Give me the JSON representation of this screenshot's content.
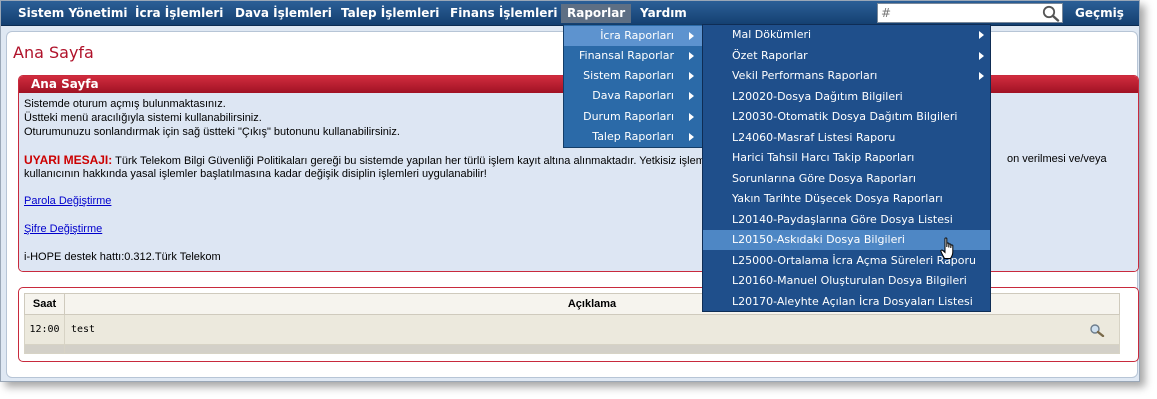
{
  "topmenu": {
    "items": [
      {
        "label": "Sistem Yönetimi"
      },
      {
        "label": "İcra İşlemleri"
      },
      {
        "label": "Dava İşlemleri"
      },
      {
        "label": "Talep İşlemleri"
      },
      {
        "label": "Finans İşlemleri"
      },
      {
        "label": "Raporlar"
      },
      {
        "label": "Yardım"
      }
    ],
    "search_placeholder": "#",
    "search_icon": "magnifier-icon",
    "history_label": "Geçmiş"
  },
  "page": {
    "title": "Ana Sayfa"
  },
  "home_panel": {
    "header": "Ana Sayfa",
    "lines": [
      "Sistemde oturum açmış bulunmaktasınız.",
      "Üstteki menü aracılığıyla sistemi kullanabilirsiniz.",
      "Oturumunuzu sonlandırmak için sağ üstteki \"Çıkış\" butonunu kullanabilirsiniz."
    ],
    "warning_label": "UYARI MESAJI:",
    "warning_text_1": "Türk Telekom Bilgi Güvenliği Politikaları gereği bu sistemde yapılan her türlü işlem kayıt altına alınmaktadır. Yetkisiz işlemlerin te",
    "warning_text_1_tail": "on verilmesi ve/veya",
    "warning_text_2": "kullanıcının hakkında yasal işlemler başlatılmasına kadar değişik disiplin işlemleri uygulanabilir!",
    "link_parola": "Parola Değiştirme",
    "link_sifre": "Şifre Değiştirme",
    "support": "i-HOPE destek hattı:0.312.Türk Telekom"
  },
  "log_table": {
    "headers": {
      "time": "Saat",
      "description": "Açıklama"
    },
    "rows": [
      {
        "time": "12:00",
        "description": "test"
      }
    ],
    "row_icon": "view-detail-icon"
  },
  "raporlar_menu": {
    "items": [
      {
        "label": "İcra Raporları",
        "selected": true
      },
      {
        "label": "Finansal Raporlar"
      },
      {
        "label": "Sistem Raporları"
      },
      {
        "label": "Dava Raporları"
      },
      {
        "label": "Durum Raporları"
      },
      {
        "label": "Talep Raporları"
      }
    ]
  },
  "icra_submenu": {
    "items": [
      {
        "label": "Mal Dökümleri",
        "has_submenu": true
      },
      {
        "label": "Özet Raporlar",
        "has_submenu": true
      },
      {
        "label": "Vekil Performans Raporları",
        "has_submenu": true
      },
      {
        "label": "L20020-Dosya Dağıtım Bilgileri"
      },
      {
        "label": "L20030-Otomatik Dosya Dağıtım Bilgileri"
      },
      {
        "label": "L24060-Masraf Listesi Raporu"
      },
      {
        "label": "Harici Tahsil Harcı Takip Raporları"
      },
      {
        "label": "Sorunlarına Göre Dosya Raporları"
      },
      {
        "label": "Yakın Tarihte Düşecek Dosya Raporları"
      },
      {
        "label": "L20140-Paydaşlarına Göre Dosya Listesi"
      },
      {
        "label": "L20150-Askıdaki Dosya Bilgileri",
        "hovered": true
      },
      {
        "label": "L25000-Ortalama İcra Açma Süreleri Raporu"
      },
      {
        "label": "L20160-Manuel Oluşturulan Dosya Bilgileri"
      },
      {
        "label": "L20170-Aleyhte Açılan İcra Dosyaları Listesi"
      }
    ]
  },
  "colors": {
    "menubar": "#1d4b80",
    "accent_red": "#b0122a",
    "menu_highlight": "#4e87c5"
  }
}
